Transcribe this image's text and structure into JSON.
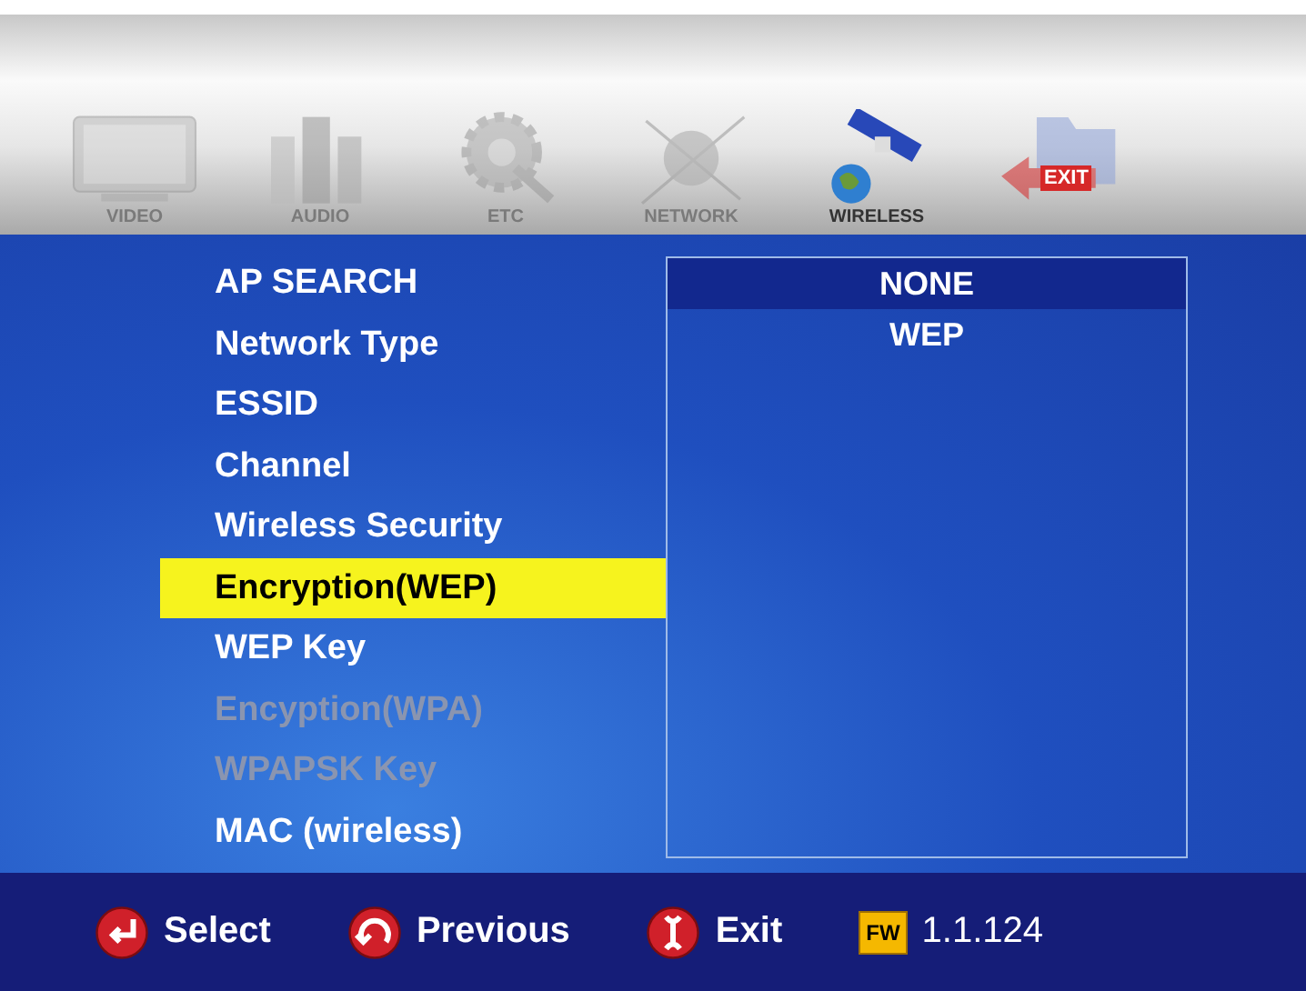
{
  "tabs": [
    {
      "kind": "tv",
      "label": "VIDEO",
      "selected": false
    },
    {
      "kind": "speakers",
      "label": "AUDIO",
      "selected": false
    },
    {
      "kind": "gear",
      "label": "ETC",
      "selected": false
    },
    {
      "kind": "globe",
      "label": "NETWORK",
      "selected": false
    },
    {
      "kind": "satellite",
      "label": "WIRELESS",
      "selected": true
    },
    {
      "kind": "exit",
      "label": "EXIT",
      "selected": false
    }
  ],
  "menu": [
    {
      "label": "AP SEARCH",
      "selected": false,
      "disabled": false
    },
    {
      "label": "Network Type",
      "selected": false,
      "disabled": false
    },
    {
      "label": "ESSID",
      "selected": false,
      "disabled": false
    },
    {
      "label": "Channel",
      "selected": false,
      "disabled": false
    },
    {
      "label": "Wireless Security",
      "selected": false,
      "disabled": false
    },
    {
      "label": "Encryption(WEP)",
      "selected": true,
      "disabled": false
    },
    {
      "label": "WEP Key",
      "selected": false,
      "disabled": false
    },
    {
      "label": "Encyption(WPA)",
      "selected": false,
      "disabled": true
    },
    {
      "label": "WPAPSK Key",
      "selected": false,
      "disabled": true
    },
    {
      "label": "MAC (wireless)",
      "selected": false,
      "disabled": false
    }
  ],
  "options": [
    {
      "label": "NONE",
      "selected": true
    },
    {
      "label": "WEP",
      "selected": false
    }
  ],
  "footer": [
    {
      "kind": "enter",
      "label": "Select"
    },
    {
      "kind": "back",
      "label": "Previous"
    },
    {
      "kind": "exit",
      "label": "Exit"
    }
  ],
  "firmware": {
    "badge": "FW",
    "version": "1.1.124"
  }
}
